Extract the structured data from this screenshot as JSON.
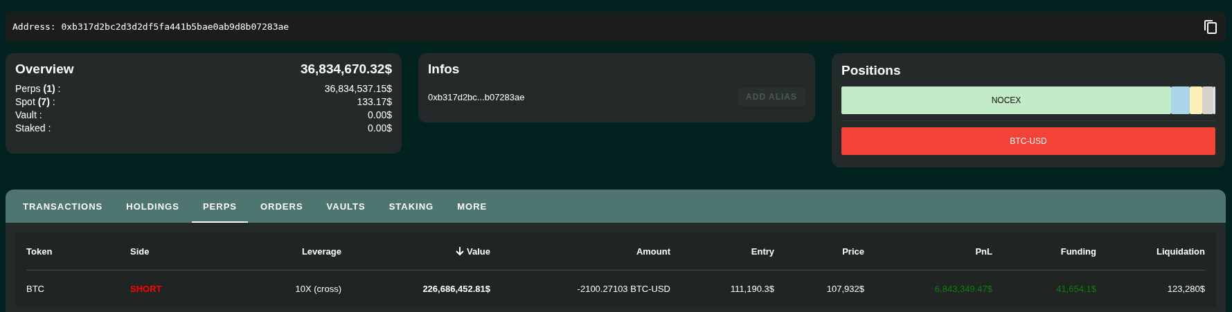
{
  "address_bar": {
    "label": "Address:",
    "value": "0xb317d2bc2d3d2df5fa441b5bae0ab9d8b07283ae"
  },
  "overview": {
    "title": "Overview",
    "total": "36,834,670.32$",
    "rows": [
      {
        "label": "Perps **(1)** :",
        "value": "36,834,537.15$"
      },
      {
        "label": "Spot **(7)** :",
        "value": "133.17$"
      },
      {
        "label": "Vault :",
        "value": "0.00$"
      },
      {
        "label": "Staked :",
        "value": "0.00$"
      }
    ]
  },
  "infos": {
    "title": "Infos",
    "address": "0xb317d2bc...b07283ae",
    "button": {
      "label": "ADD ALIAS",
      "disabled": true
    }
  },
  "positions": {
    "title": "Positions",
    "bars": [
      {
        "segments": [
          {
            "label": "NOCEX",
            "color": "#c1ebc9"
          },
          {
            "color": "#aad5e8"
          },
          {
            "color": "#fdf1b8"
          },
          {
            "color": "#d5d2c9"
          },
          {
            "color": "#e6e0ef"
          }
        ]
      },
      {
        "segments": [
          {
            "label": "BTC-USD",
            "color": "#f44336"
          }
        ]
      }
    ]
  },
  "tabs": [
    {
      "label": "TRANSACTIONS",
      "selected": false
    },
    {
      "label": "HOLDINGS",
      "selected": false
    },
    {
      "label": "PERPS",
      "selected": true
    },
    {
      "label": "ORDERS",
      "selected": false
    },
    {
      "label": "VAULTS",
      "selected": false
    },
    {
      "label": "STAKING",
      "selected": false
    },
    {
      "label": "MORE",
      "selected": false
    }
  ],
  "table": {
    "columns": [
      {
        "label": "Token",
        "sorted": false
      },
      {
        "label": "Side",
        "sorted": false
      },
      {
        "label": "Leverage",
        "sorted": false
      },
      {
        "label": "Value",
        "sorted": true
      },
      {
        "label": "Amount",
        "sorted": false
      },
      {
        "label": "Entry",
        "sorted": false
      },
      {
        "label": "Price",
        "sorted": false
      },
      {
        "label": "PnL",
        "sorted": false
      },
      {
        "label": "Funding",
        "sorted": false
      },
      {
        "label": "Liquidation",
        "sorted": false
      }
    ],
    "rows": [
      {
        "cells": [
          {
            "text": "BTC",
            "kind": "plain"
          },
          {
            "text": "SHORT",
            "kind": "negative"
          },
          {
            "text": "10X (cross)",
            "kind": "plain"
          },
          {
            "text": "226,686,452.81$",
            "kind": "bold"
          },
          {
            "text": "-2100.27103 BTC-USD",
            "kind": "plain"
          },
          {
            "text": "111,190.3$",
            "kind": "plain"
          },
          {
            "text": "107,932$",
            "kind": "plain"
          },
          {
            "text": "6,843,349.47$",
            "kind": "positive"
          },
          {
            "text": "41,654.1$",
            "kind": "positive"
          },
          {
            "text": "123,280$",
            "kind": "plain"
          }
        ]
      }
    ]
  }
}
